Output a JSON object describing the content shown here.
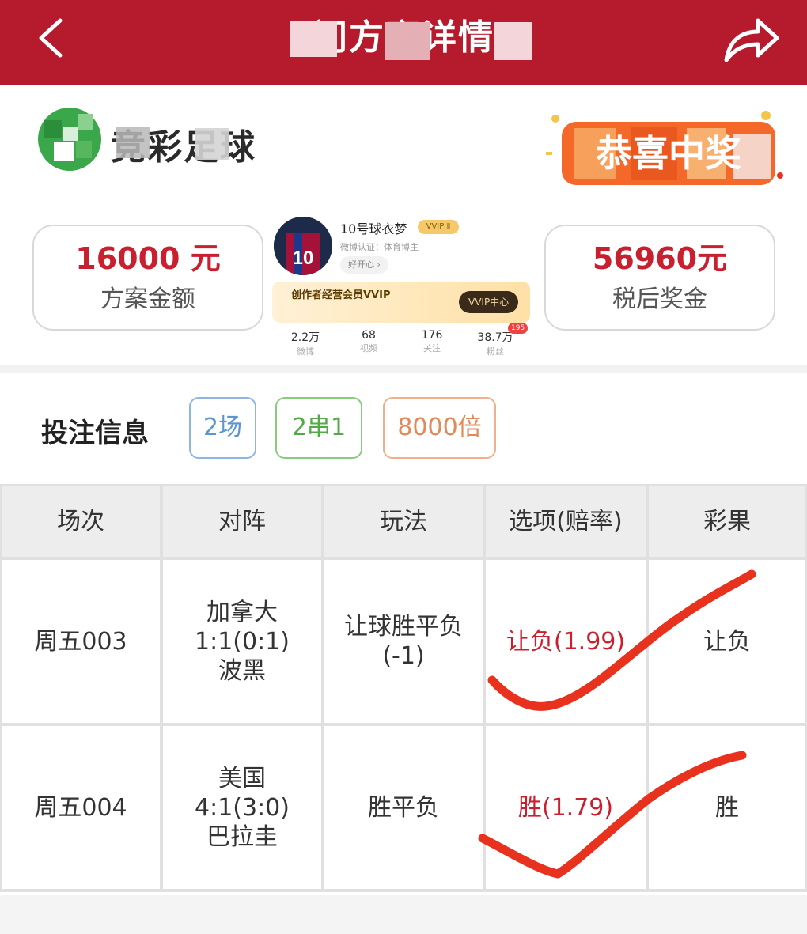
{
  "header": {
    "title": "门方案详情",
    "back_icon": "chevron-left-icon",
    "share_icon": "share-arrow-icon",
    "bg_color": "#b51a2d"
  },
  "brand": {
    "name": "竞彩足球",
    "logo_icon": "soccer-ball-logo",
    "congrats_badge": "恭喜中奖"
  },
  "summary": {
    "plan_amount": "16000 元",
    "plan_amount_label": "方案金额",
    "prize_amount": "56960元",
    "prize_amount_label": "税后奖金"
  },
  "profile": {
    "name": "10号球衣梦",
    "vip_tag": "VVIP Ⅱ",
    "certification": "微博认证：体育博主",
    "mood": "好开心 ›",
    "banner_text": "创作者经营会员VVIP",
    "banner_button": "VVIP中心",
    "stats": [
      {
        "value": "2.2万",
        "label": "微博"
      },
      {
        "value": "68",
        "label": "视频"
      },
      {
        "value": "176",
        "label": "关注"
      },
      {
        "value": "38.7万",
        "label": "粉丝"
      }
    ],
    "fans_badge": "195"
  },
  "bet_info": {
    "title": "投注信息",
    "matches_chip": "2场",
    "combo_chip": "2串1",
    "multiplier_chip": "8000倍"
  },
  "table": {
    "headers": [
      "场次",
      "对阵",
      "玩法",
      "选项(赔率)",
      "彩果"
    ],
    "rows": [
      {
        "match_no": "周五003",
        "home": "加拿大",
        "score": "1:1(0:1)",
        "away": "波黑",
        "play_line1": "让球胜平负",
        "play_line2": "(-1)",
        "option": "让负(1.99)",
        "result": "让负"
      },
      {
        "match_no": "周五004",
        "home": "美国",
        "score": "4:1(3:0)",
        "away": "巴拉圭",
        "play_line1": "胜平负",
        "play_line2": "",
        "option": "胜(1.79)",
        "result": "胜"
      }
    ]
  },
  "colors": {
    "accent_red": "#c9202f",
    "check_mark": "#e8321e"
  }
}
